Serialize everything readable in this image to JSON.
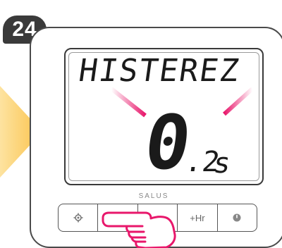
{
  "step": {
    "number": "24"
  },
  "display": {
    "label": "HISTEREZ",
    "value_integer": "0",
    "value_decimal": ".2",
    "unit": "s"
  },
  "brand": "SALUS",
  "buttons": [
    {
      "name": "settings-button",
      "icon": "gear-icon",
      "label": ""
    },
    {
      "name": "confirm-button",
      "icon": "check-icon",
      "label": ""
    },
    {
      "name": "up-button",
      "icon": "chevron-up-icon",
      "label": ""
    },
    {
      "name": "plus-hour-button",
      "icon": "",
      "label": "+Hr"
    },
    {
      "name": "power-button",
      "icon": "power-icon",
      "label": ""
    }
  ],
  "colors": {
    "ray": "#e8176b",
    "arrow": "#fbc750",
    "badge": "#3a3a3a",
    "hand": "#e8176b"
  }
}
